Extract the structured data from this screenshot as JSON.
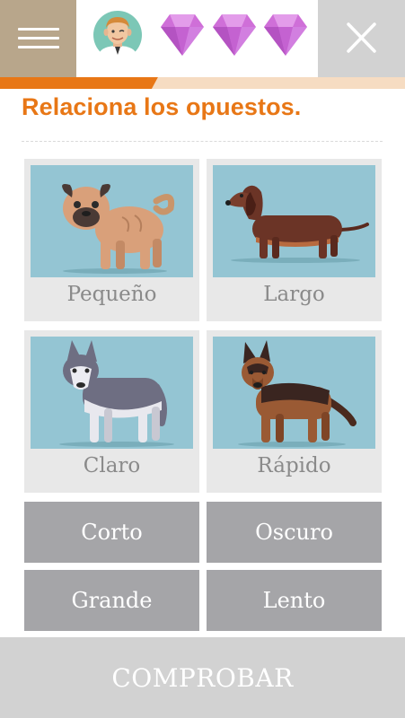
{
  "header": {
    "menu_icon": "hamburger-menu-icon",
    "avatar_icon": "avatar-icon",
    "gem_icon": "gem-icon",
    "gems_count": 3,
    "close_icon": "close-icon"
  },
  "progress": {
    "fraction": 0.39,
    "fill_color": "#e87716",
    "track_color": "#f6dcc2"
  },
  "exercise": {
    "title": "Relaciona los opuestos.",
    "title_color": "#e87716",
    "cards": [
      {
        "label": "Pequeño",
        "image": "pug-dog-image"
      },
      {
        "label": "Largo",
        "image": "dachshund-dog-image"
      },
      {
        "label": "Claro",
        "image": "husky-dog-image"
      },
      {
        "label": "Rápido",
        "image": "german-shepherd-dog-image"
      }
    ],
    "words": [
      "Corto",
      "Oscuro",
      "Grande",
      "Lento"
    ]
  },
  "check_button": {
    "label": "COMPROBAR"
  }
}
